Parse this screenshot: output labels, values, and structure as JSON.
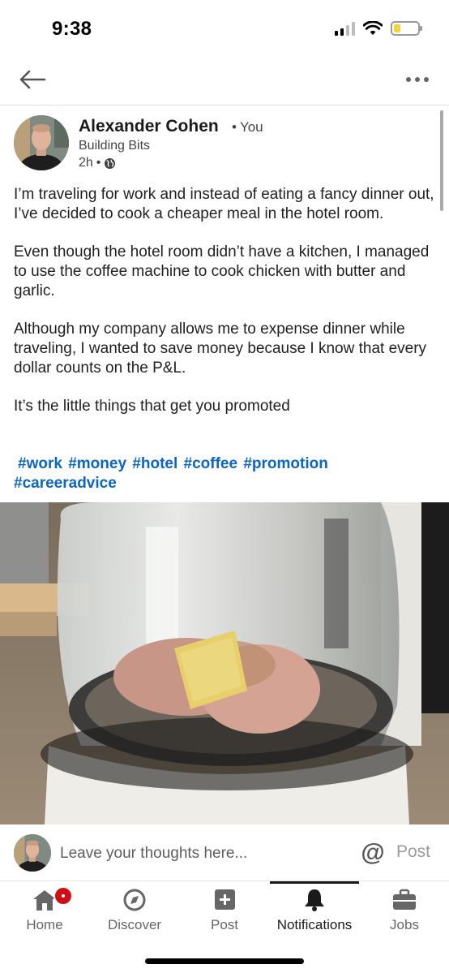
{
  "status_bar": {
    "time": "9:38",
    "icons": [
      "cellular-signal-icon",
      "wifi-icon",
      "battery-icon"
    ],
    "battery_level": 0.3,
    "battery_color": "#f3d23a"
  },
  "nav": {
    "back_icon": "back-arrow-icon",
    "more_icon": "more-horizontal-icon"
  },
  "post": {
    "author": {
      "name": "Alexander Cohen",
      "degree": "You",
      "headline": "Building Bits"
    },
    "time": "2h",
    "visibility_icon": "globe-icon",
    "paragraphs": [
      "I’m traveling for work and instead of eating a fancy dinner out, I’ve decided to cook a cheaper meal in the hotel room.",
      "Even though the hotel room didn’t have a kitchen, I managed to use the coffee machine to cook chicken with butter and garlic.",
      "Although my company allows me to expense dinner while traveling, I wanted to save money because I know that every dollar counts on the P&L.",
      "It’s the little things that get you promoted"
    ],
    "hashtags": [
      "#work",
      "#money",
      "#hotel",
      "#coffee",
      "#promotion",
      "#careeradvice"
    ],
    "link_color": "#0a66c2"
  },
  "comment_bar": {
    "placeholder": "Leave your thoughts here...",
    "mention_symbol": "@",
    "post_label": "Post"
  },
  "tabs": [
    {
      "label": "Home",
      "icon": "home-icon",
      "badge": true
    },
    {
      "label": "Discover",
      "icon": "compass-icon"
    },
    {
      "label": "Post",
      "icon": "plus-square-icon"
    },
    {
      "label": "Notifications",
      "icon": "bell-icon",
      "active": true
    },
    {
      "label": "Jobs",
      "icon": "briefcase-icon"
    }
  ],
  "colors": {
    "badge": "#cc1016",
    "active_tab": "#1a1a1a"
  }
}
